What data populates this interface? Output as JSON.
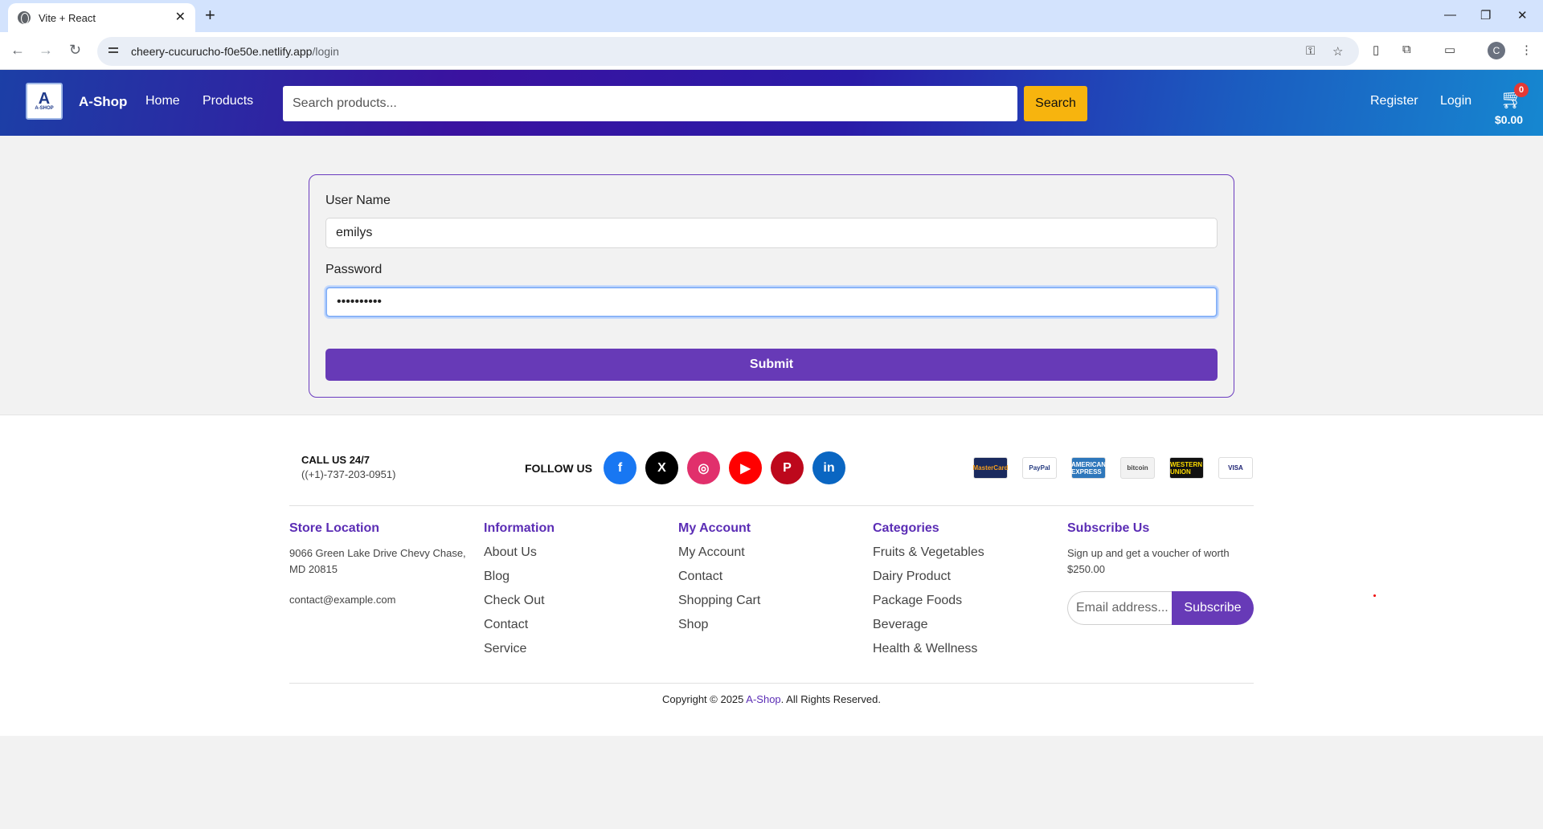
{
  "browser": {
    "tab_title": "Vite + React",
    "url_host": "cheery-cucurucho-f0e50e.netlify.app",
    "url_path": "/login",
    "profile_initial": "C"
  },
  "header": {
    "logo_mark": "A",
    "logo_sub": "A-SHOP",
    "brand": "A-Shop",
    "nav": [
      "Home",
      "Products"
    ],
    "search_placeholder": "Search products...",
    "search_button": "Search",
    "register": "Register",
    "login": "Login",
    "cart_count": "0",
    "cart_total": "$0.00"
  },
  "login_form": {
    "username_label": "User Name",
    "username_value": "emilys",
    "password_label": "Password",
    "password_value": "emilyspass",
    "submit": "Submit"
  },
  "footer": {
    "call_title": "CALL US 24/7",
    "call_phone": "((+1)-737-203-0951)",
    "follow_label": "FOLLOW US",
    "social": [
      {
        "name": "facebook-icon",
        "glyph": "f",
        "color": "#1877f2"
      },
      {
        "name": "x-icon",
        "glyph": "X",
        "color": "#000000"
      },
      {
        "name": "instagram-icon",
        "glyph": "◎",
        "color": "#e1306c"
      },
      {
        "name": "youtube-icon",
        "glyph": "▶",
        "color": "#ff0000"
      },
      {
        "name": "pinterest-icon",
        "glyph": "P",
        "color": "#bd081c"
      },
      {
        "name": "linkedin-icon",
        "glyph": "in",
        "color": "#0a66c2"
      }
    ],
    "payments": [
      {
        "name": "mastercard-icon",
        "label": "MasterCard",
        "bg": "#1a2a5e",
        "fg": "#f79e1b"
      },
      {
        "name": "paypal-icon",
        "label": "PayPal",
        "bg": "#ffffff",
        "fg": "#253b80"
      },
      {
        "name": "amex-icon",
        "label": "AMERICAN EXPRESS",
        "bg": "#2e77bb",
        "fg": "#ffffff"
      },
      {
        "name": "bitcoin-icon",
        "label": "bitcoin",
        "bg": "#f2f2f2",
        "fg": "#444444"
      },
      {
        "name": "western-union-icon",
        "label": "WESTERN UNION",
        "bg": "#111111",
        "fg": "#ffdd00"
      },
      {
        "name": "visa-icon",
        "label": "VISA",
        "bg": "#ffffff",
        "fg": "#1a1f71"
      }
    ],
    "store": {
      "title": "Store Location",
      "address": "9066 Green Lake Drive Chevy Chase, MD 20815",
      "email": "contact@example.com"
    },
    "information": {
      "title": "Information",
      "links": [
        "About Us",
        "Blog",
        "Check Out",
        "Contact",
        "Service"
      ]
    },
    "account": {
      "title": "My Account",
      "links": [
        "My Account",
        "Contact",
        "Shopping Cart",
        "Shop"
      ]
    },
    "categories": {
      "title": "Categories",
      "links": [
        "Fruits & Vegetables",
        "Dairy Product",
        "Package Foods",
        "Beverage",
        "Health & Wellness"
      ]
    },
    "subscribe": {
      "title": "Subscribe Us",
      "text": "Sign up and get a voucher of worth $250.00",
      "placeholder": "Email address...",
      "button": "Subscribe"
    },
    "copyright_prefix": "Copyright © 2025 ",
    "copyright_brand": "A-Shop",
    "copyright_suffix": ". All Rights Reserved."
  },
  "colors": {
    "accent": "#673ab7",
    "search_button": "#f7b40e",
    "header_gradient_start": "#1c3fa6",
    "header_gradient_end": "#1687d0"
  }
}
